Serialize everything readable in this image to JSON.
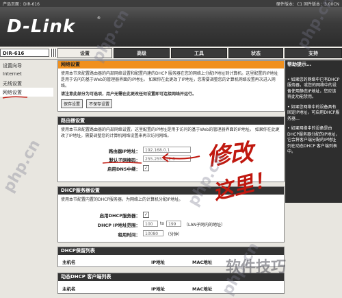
{
  "topbar": {
    "product_page": "产品页面：DIR-616",
    "versions": "硬件版本：C1   固件版本：3.00CN"
  },
  "logo": {
    "text": "D-Link",
    "reg": "®"
  },
  "model": "DIR-616",
  "tabs": [
    "设置",
    "高级",
    "工具",
    "状态",
    "支持"
  ],
  "leftnav": [
    "设置向导",
    "Internet",
    "无线设置",
    "网络设置"
  ],
  "network_panel": {
    "title": "网络设置",
    "desc": "使用本节来配置路由器的内部网络设置和配置内建的DHCP 服务器在您的网络上分配IP地址到计算机。这里配置的IP地址是用于访问的基于Web的管理器界面的IP地址。 如果你在此更改了IP地址，您需要调整您的计算机网络设置再次进入网络。",
    "note": "请注意此部分为可选项，用户无需在此更改任何设置即可连接网络并运行。",
    "save_btn": "保存设置",
    "nosave_btn": "不保存设置"
  },
  "router_panel": {
    "title": "路由器设置",
    "desc": "使用本节来配置路由器的内部网络设置。这里配置的IP地址是用于访问的基于Web的管理器界面的IP地址。 如果你在此更改了IP地址，需要调整您的计算机网络设置来再次访问网络。",
    "ip_label": "路由器IP地址：",
    "ip_value": "192.168.0.1",
    "mask_label": "默认子网掩码：",
    "mask_value": "255.255.252.0",
    "dns_label": "启用DNS中继："
  },
  "dhcp_panel": {
    "title": "DHCP服务器设置",
    "desc": "使用本节配置内置的DHCP服务器，为网络上的计算机分配IP地址。",
    "enable_label": "启用DHCP服务器：",
    "range_label": "DHCP IP地址范围：",
    "range_start": "100",
    "range_to": "to",
    "range_end": "199",
    "range_note": "（LAN子网内的地址）",
    "lease_label": "租用时间：",
    "lease_value": "10080",
    "lease_unit": "（分钟）"
  },
  "reservation_panel": {
    "title": "DHCP保留列表",
    "cols": [
      "主机名",
      "IP地址",
      "MAC地址"
    ]
  },
  "client_panel": {
    "title": "动态DHCP 客户端列表",
    "cols": [
      "主机名",
      "IP地址",
      "MAC地址"
    ]
  },
  "help": {
    "title": "帮助提示…",
    "p1": "• 如果您的网络中已有DHCP服务器，或您的网络中的设备使用静态IP地址，您应该将此功能禁用。",
    "p2": "• 如果您网络中的设备具有固定IP地址，可启用DHCP服务器…",
    "p3": "• 如果网络中的设备是由DHCP服务器分配的IP地址，它会将客户端分配的IP地址列在动态DHCP 客户端列表中。"
  },
  "annotation": {
    "line1": "修改",
    "line2": "这里！"
  },
  "watermark": {
    "site": "php.cn",
    "brand": "软件技巧"
  },
  "colors": {
    "orange": "#f0901e",
    "dark": "#333333",
    "annotation_red": "#c0180f"
  }
}
